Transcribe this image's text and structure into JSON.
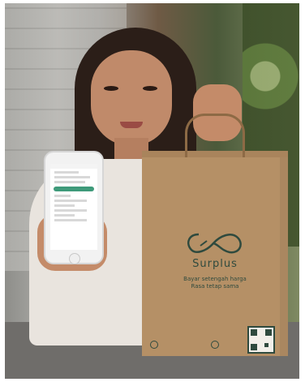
{
  "photo": {
    "bag": {
      "brand": "Surplus",
      "tagline_line1": "Bayar setengah harga",
      "tagline_line2": "Rasa tetap sama"
    }
  }
}
